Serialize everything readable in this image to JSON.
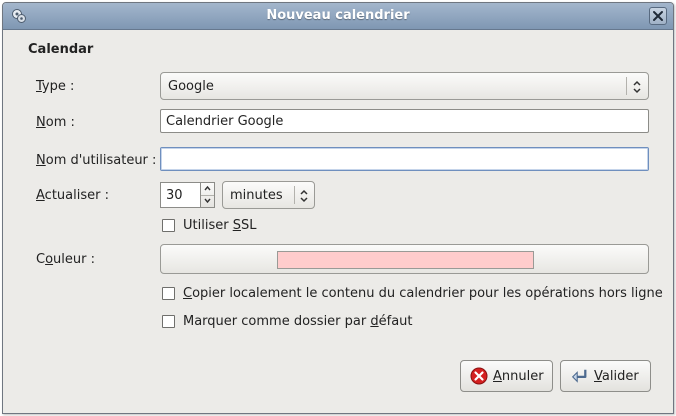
{
  "window": {
    "title": "Nouveau calendrier"
  },
  "section": {
    "title": "Calendar"
  },
  "form": {
    "type": {
      "label_mnemonic": "T",
      "label_rest": "ype :",
      "value": "Google"
    },
    "nom": {
      "label_mnemonic": "N",
      "label_rest": "om :",
      "value": "Calendrier Google"
    },
    "username": {
      "label_mnemonic": "N",
      "label_rest": "om d'utilisateur :",
      "value": ""
    },
    "refresh": {
      "label_mnemonic": "A",
      "label_rest": "ctualiser :",
      "value": "30",
      "unit": "minutes"
    },
    "ssl": {
      "label_pre": "Utiliser ",
      "label_mnemonic": "S",
      "label_rest": "SL",
      "checked": false
    },
    "color": {
      "label_pre": "C",
      "label_mnemonic": "o",
      "label_rest": "uleur :",
      "value": "#ffcccc"
    },
    "copy_local": {
      "label_mnemonic": "C",
      "label_rest": "opier localement le contenu du calendrier pour les opérations hors ligne",
      "checked": false
    },
    "default_folder": {
      "label_pre": "Marquer comme dossier par ",
      "label_mnemonic": "d",
      "label_rest": "éfaut",
      "checked": false
    }
  },
  "buttons": {
    "cancel": {
      "mnemonic": "A",
      "rest": "nnuler"
    },
    "ok": {
      "mnemonic": "V",
      "rest": "alider"
    }
  },
  "colors": {
    "titlebar": "#8fa5bf",
    "dialog_bg": "#ecebe8",
    "cancel_icon": "#d42020"
  }
}
